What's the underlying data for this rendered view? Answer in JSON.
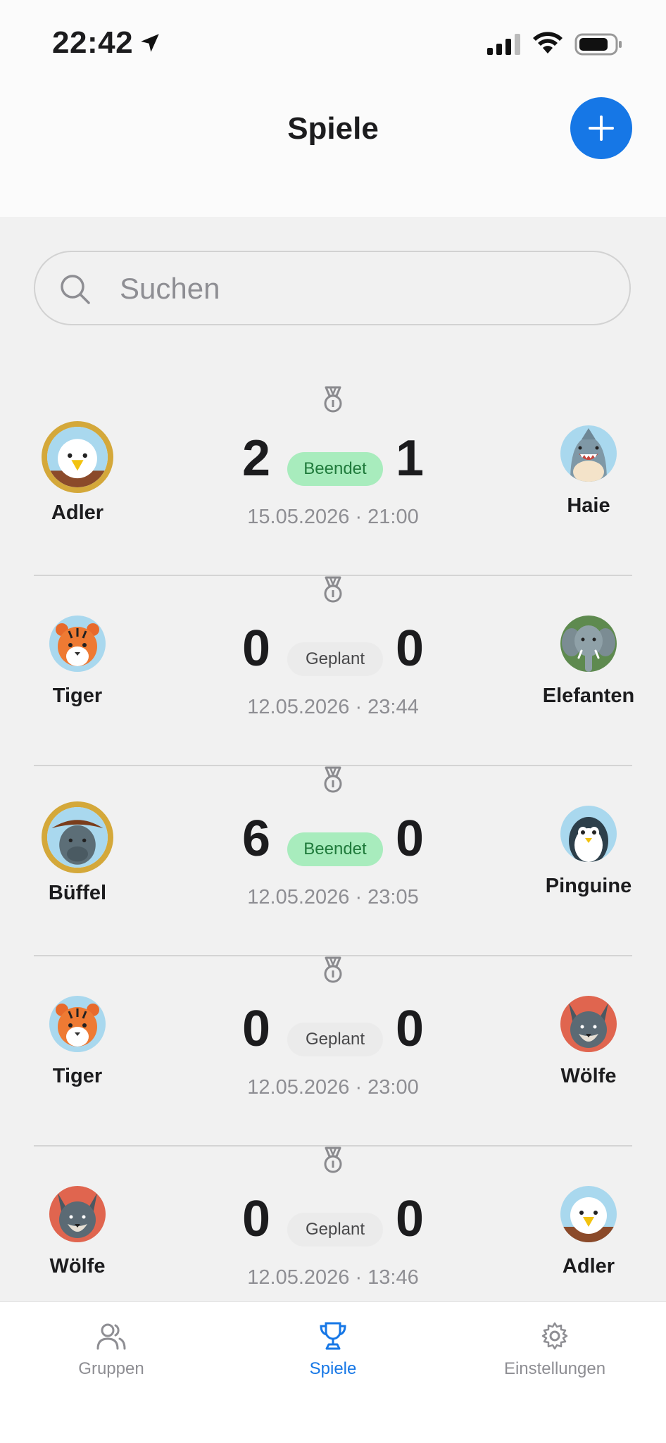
{
  "status": {
    "time": "22:42"
  },
  "header": {
    "title": "Spiele"
  },
  "search": {
    "placeholder": "Suchen"
  },
  "matches": [
    {
      "home": "Adler",
      "away": "Haie",
      "home_score": "2",
      "away_score": "1",
      "status": "Beendet",
      "date": "15.05.2026 · 21:00",
      "winner": "home"
    },
    {
      "home": "Tiger",
      "away": "Elefanten",
      "home_score": "0",
      "away_score": "0",
      "status": "Geplant",
      "date": "12.05.2026 · 23:44",
      "winner": "none"
    },
    {
      "home": "Büffel",
      "away": "Pinguine",
      "home_score": "6",
      "away_score": "0",
      "status": "Beendet",
      "date": "12.05.2026 · 23:05",
      "winner": "home"
    },
    {
      "home": "Tiger",
      "away": "Wölfe",
      "home_score": "0",
      "away_score": "0",
      "status": "Geplant",
      "date": "12.05.2026 · 23:00",
      "winner": "none"
    },
    {
      "home": "Wölfe",
      "away": "Adler",
      "home_score": "0",
      "away_score": "0",
      "status": "Geplant",
      "date": "12.05.2026 · 13:46",
      "winner": "none"
    }
  ],
  "tabbar": {
    "groups": "Gruppen",
    "games": "Spiele",
    "settings": "Einstellungen"
  },
  "colors": {
    "accent": "#1677e6",
    "done_badge": "#a8ecbd",
    "winner_ring": "#d4a83a"
  }
}
